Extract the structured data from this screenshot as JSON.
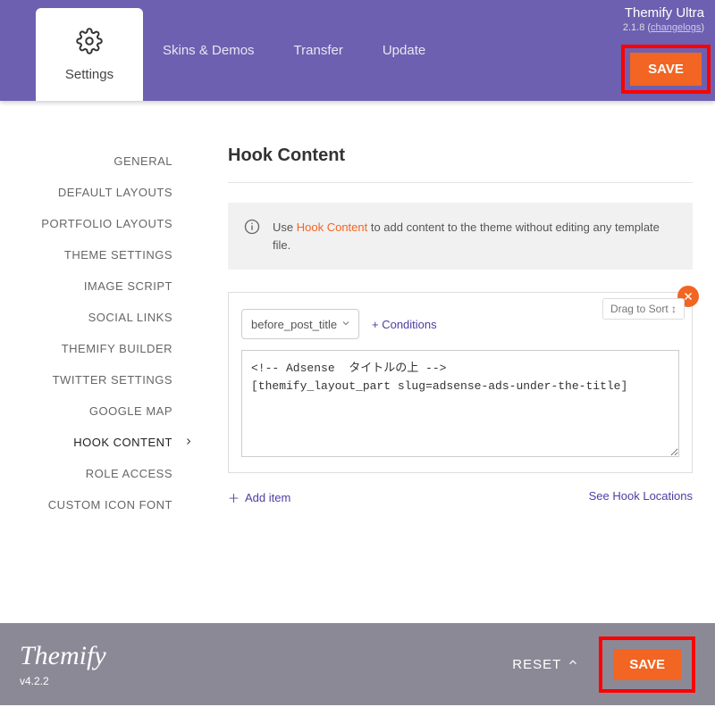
{
  "header": {
    "tabs": [
      "Settings",
      "Skins & Demos",
      "Transfer",
      "Update"
    ],
    "theme_name": "Themify Ultra",
    "theme_version": "2.1.8",
    "changelogs_label": "changelogs",
    "save_label": "SAVE"
  },
  "sidebar": {
    "items": [
      "GENERAL",
      "DEFAULT LAYOUTS",
      "PORTFOLIO LAYOUTS",
      "THEME SETTINGS",
      "IMAGE SCRIPT",
      "SOCIAL LINKS",
      "THEMIFY BUILDER",
      "TWITTER SETTINGS",
      "GOOGLE MAP",
      "HOOK CONTENT",
      "ROLE ACCESS",
      "CUSTOM ICON FONT"
    ],
    "active_index": 9
  },
  "main": {
    "title": "Hook Content",
    "notice_prefix": "Use ",
    "notice_link": "Hook Content",
    "notice_suffix": " to add content to the theme without editing any template file.",
    "hook": {
      "drag_label": "Drag to Sort",
      "position_value": "before_post_title",
      "conditions_label": "+ Conditions",
      "code": "<!-- Adsense  タイトルの上 -->\n[themify_layout_part slug=adsense-ads-under-the-title]"
    },
    "add_item_label": "Add item",
    "see_hooks_label": "See Hook Locations"
  },
  "footer": {
    "brand": "Themify",
    "version": "v4.2.2",
    "reset_label": "RESET",
    "save_label": "SAVE"
  },
  "colors": {
    "accent_purple": "#6d60b0",
    "accent_orange": "#f26522",
    "highlight_red": "#ff0000"
  }
}
